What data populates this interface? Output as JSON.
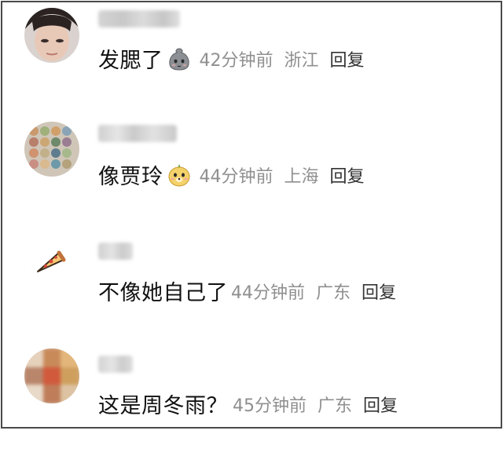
{
  "comments": [
    {
      "text": "发腮了",
      "emoji_icon": "shy-face-emoji-icon",
      "time": "42分钟前",
      "location": "浙江",
      "reply_label": "回复"
    },
    {
      "text": "像贾玲",
      "emoji_icon": "puppy-face-emoji-icon",
      "time": "44分钟前",
      "location": "上海",
      "reply_label": "回复"
    },
    {
      "text": "不像她自己了",
      "emoji_icon": "",
      "time": "44分钟前",
      "location": "广东",
      "reply_label": "回复"
    },
    {
      "text": "这是周冬雨？",
      "emoji_icon": "",
      "time": "45分钟前",
      "location": "广东",
      "reply_label": "回复"
    }
  ],
  "colors": {
    "text": "#111111",
    "meta": "#8f8f8f",
    "reply": "#333333",
    "border": "#4a4a4a"
  }
}
